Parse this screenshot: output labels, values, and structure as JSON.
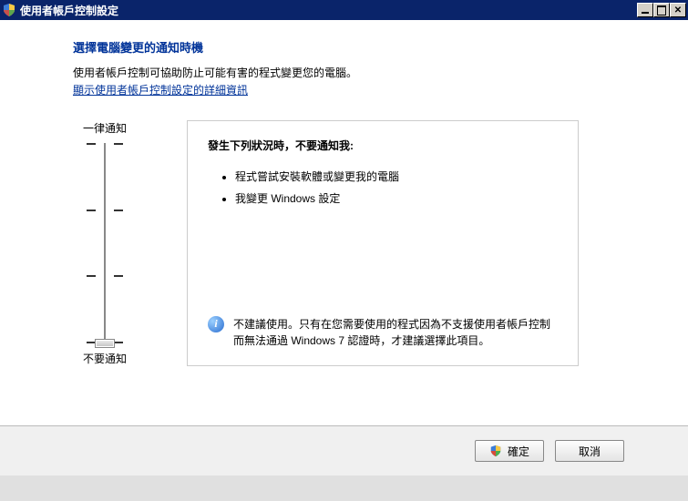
{
  "titlebar": {
    "title": "使用者帳戶控制設定"
  },
  "heading": "選擇電腦變更的通知時機",
  "description": "使用者帳戶控制可協助防止可能有害的程式變更您的電腦。",
  "link": "顯示使用者帳戶控制設定的詳細資訊",
  "slider": {
    "top_label": "一律通知",
    "bottom_label": "不要通知"
  },
  "panel": {
    "heading": "發生下列狀況時，不要通知我:",
    "items": [
      "程式嘗試安裝軟體或變更我的電腦",
      "我變更 Windows 設定"
    ],
    "warning": "不建議使用。只有在您需要使用的程式因為不支援使用者帳戶控制而無法通過 Windows 7 認證時，才建議選擇此項目。"
  },
  "buttons": {
    "ok": "確定",
    "cancel": "取消"
  }
}
